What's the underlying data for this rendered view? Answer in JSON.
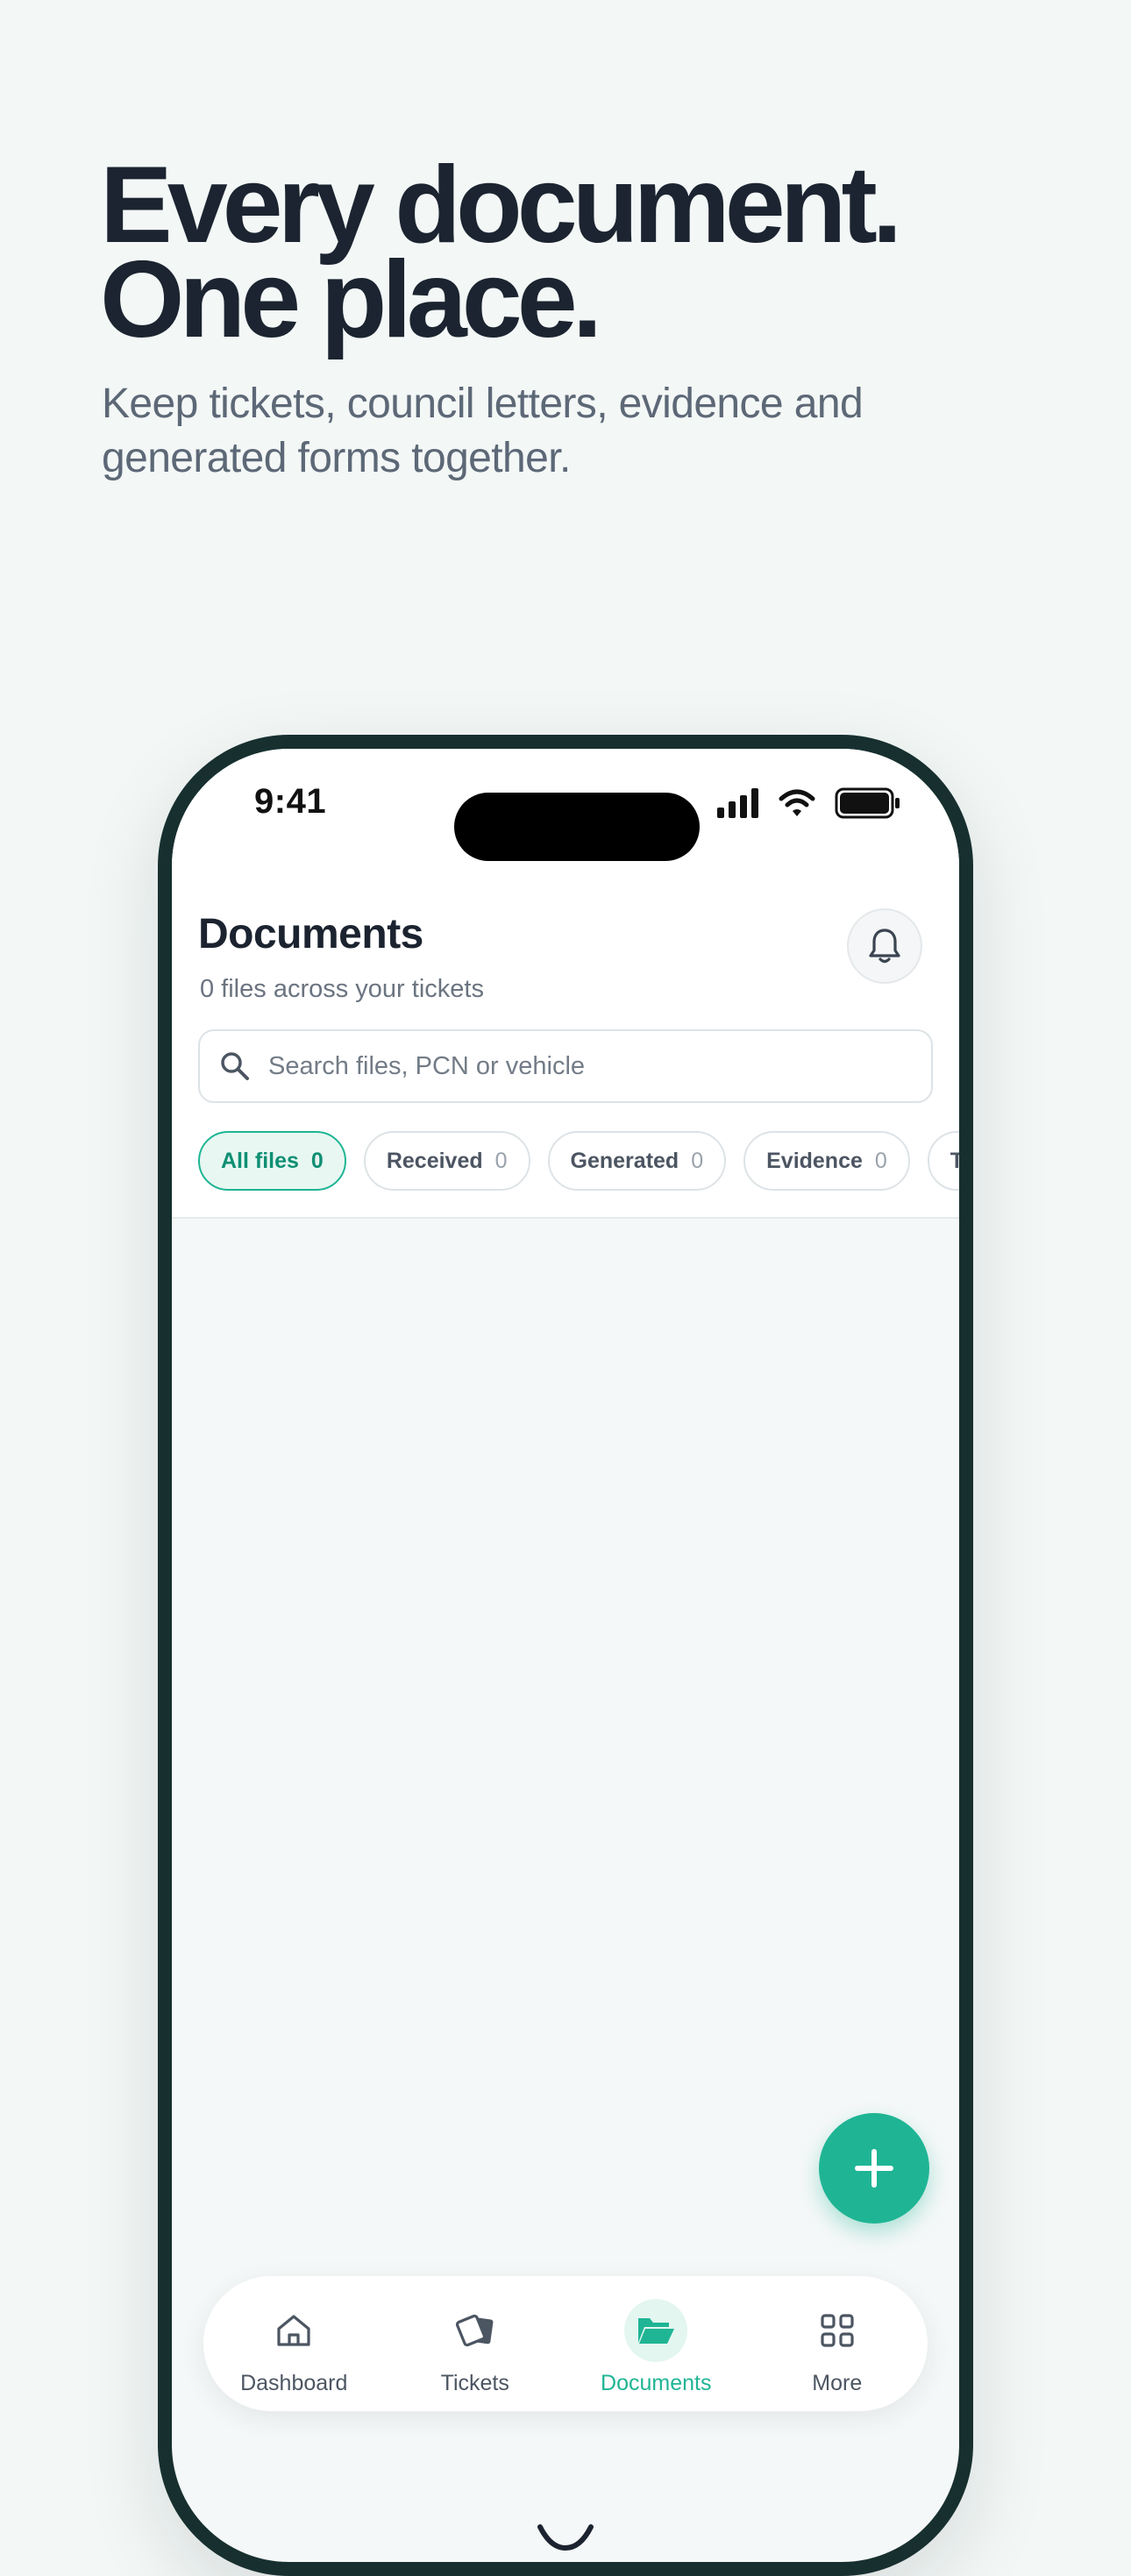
{
  "hero": {
    "title_line1": "Every document.",
    "title_line2": "One place.",
    "subtitle": "Keep tickets, council letters, evidence and generated forms together."
  },
  "status_bar": {
    "time": "9:41",
    "icons": [
      "cellular-signal-icon",
      "wifi-icon",
      "battery-icon"
    ]
  },
  "header": {
    "title": "Documents",
    "subtitle": "0 files across your tickets",
    "notification_icon": "bell-icon"
  },
  "search": {
    "placeholder": "Search files, PCN or vehicle",
    "value": ""
  },
  "filters": [
    {
      "label": "All files",
      "count": "0",
      "active": true
    },
    {
      "label": "Received",
      "count": "0",
      "active": false
    },
    {
      "label": "Generated",
      "count": "0",
      "active": false
    },
    {
      "label": "Evidence",
      "count": "0",
      "active": false
    },
    {
      "label": "T",
      "count": "",
      "active": false
    }
  ],
  "content": {
    "state": "loading",
    "loading_icon": "spinner-icon"
  },
  "fab": {
    "icon": "plus-icon"
  },
  "bottom_nav": [
    {
      "label": "Dashboard",
      "icon": "home-icon",
      "active": false
    },
    {
      "label": "Tickets",
      "icon": "tickets-icon",
      "active": false
    },
    {
      "label": "Documents",
      "icon": "folder-open-icon",
      "active": true
    },
    {
      "label": "More",
      "icon": "grid-icon",
      "active": false
    }
  ],
  "colors": {
    "accent": "#1fb594",
    "accent_light": "#e8f7f2",
    "heading": "#1b2430",
    "muted_text": "#5d6877",
    "phone_frame": "#17302f",
    "background": "#f3f7f6"
  }
}
